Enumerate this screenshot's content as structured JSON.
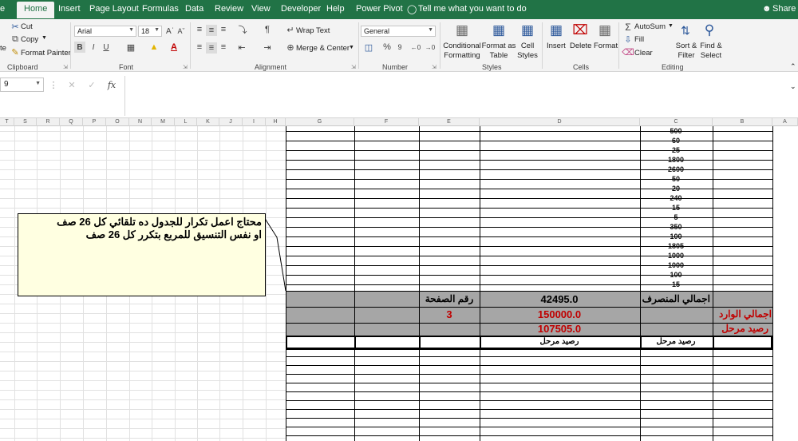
{
  "tabs": {
    "file_partial": "e",
    "home": "Home",
    "insert": "Insert",
    "page_layout": "Page Layout",
    "formulas": "Formulas",
    "data": "Data",
    "review": "Review",
    "view": "View",
    "developer": "Developer",
    "help": "Help",
    "power_pivot": "Power Pivot",
    "tell_me": "Tell me what you want to do",
    "share": "Share"
  },
  "clipboard": {
    "cut": "Cut",
    "copy": "Copy",
    "format_painter": "Format Painter",
    "paste_partial": "te",
    "group": "Clipboard"
  },
  "font": {
    "name": "Arial",
    "size": "18",
    "group": "Font",
    "bold": "B",
    "italic": "I",
    "underline": "U"
  },
  "alignment": {
    "wrap_text": "Wrap Text",
    "merge_center": "Merge & Center",
    "group": "Alignment"
  },
  "number": {
    "format": "General",
    "percent": "%",
    "comma": "9",
    "group": "Number"
  },
  "styles": {
    "conditional_formatting": "Conditional Formatting",
    "format_as_table": "Format as Table",
    "cell_styles": "Cell Styles",
    "group": "Styles"
  },
  "cells": {
    "insert": "Insert",
    "delete": "Delete",
    "format": "Format",
    "group": "Cells"
  },
  "editing": {
    "autosum": "AutoSum",
    "fill": "Fill",
    "clear": "Clear",
    "sort_filter": "Sort & Filter",
    "find_select": "Find & Select",
    "group": "Editing"
  },
  "namebox": {
    "value": "9"
  },
  "formula_bar": {
    "fx": "fx",
    "value": ""
  },
  "columns": [
    "T",
    "S",
    "R",
    "Q",
    "P",
    "O",
    "N",
    "M",
    "L",
    "K",
    "J",
    "I",
    "H",
    "G",
    "F",
    "E",
    "D",
    "C",
    "B",
    "A"
  ],
  "column_c_values": [
    "500",
    "60",
    "25",
    "1800",
    "2600",
    "50",
    "20",
    "240",
    "15",
    "5",
    "350",
    "100",
    "1805",
    "1000",
    "1000",
    "100",
    "15"
  ],
  "summary": {
    "total_spent_label": "اجمالي المنصرف",
    "total_spent_value": "42495.0",
    "page_no_label": "رقم الصفحة",
    "total_in_label": "اجمالي الوارد",
    "total_in_value": "150000.0",
    "page_no_value": "3",
    "balance_label": "رصيد مرحل",
    "balance_value": "107505.0",
    "carry_c": "رصيد مرحل",
    "carry_d": "رصيد مرحل"
  },
  "comment": {
    "line1": "محتاج اعمل تكرار للجدول ده تلقائي كل 26 صف",
    "line2": "او نفس التنسيق للمربع بتكرر كل 26 صف"
  },
  "colors": {
    "excel_green": "#217346",
    "red": "#c00000",
    "band_gray": "#a6a6a6",
    "comment_bg": "#ffffe1"
  }
}
